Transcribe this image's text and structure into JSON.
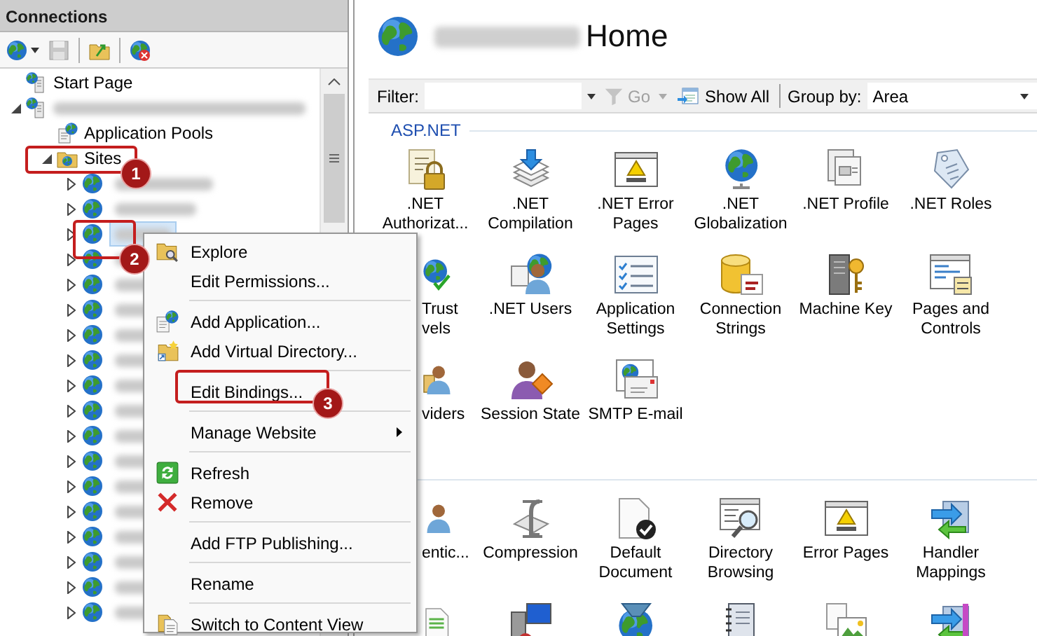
{
  "connections": {
    "title": "Connections",
    "tree": [
      {
        "kind": "start-page",
        "label": "Start Page"
      },
      {
        "kind": "server",
        "expanded": true,
        "children": [
          {
            "kind": "app-pools",
            "label": "Application Pools"
          },
          {
            "kind": "sites",
            "label": "Sites",
            "expanded": true,
            "callout": "1",
            "children": [
              {
                "kind": "site",
                "expanded": false,
                "selected": false
              },
              {
                "kind": "site",
                "expanded": false,
                "selected": false
              },
              {
                "kind": "site",
                "expanded": false,
                "selected": true,
                "callout": "2"
              },
              {
                "kind": "site",
                "expanded": false,
                "selected": false
              },
              {
                "kind": "site",
                "expanded": false,
                "selected": false
              },
              {
                "kind": "site",
                "expanded": false,
                "selected": false
              },
              {
                "kind": "site",
                "expanded": false,
                "selected": false
              },
              {
                "kind": "site",
                "expanded": false,
                "selected": false
              },
              {
                "kind": "site",
                "expanded": false,
                "selected": false
              },
              {
                "kind": "site",
                "expanded": false,
                "selected": false
              },
              {
                "kind": "site",
                "expanded": false,
                "selected": false
              },
              {
                "kind": "site",
                "expanded": false,
                "selected": false
              },
              {
                "kind": "site",
                "expanded": false,
                "selected": false
              },
              {
                "kind": "site",
                "expanded": false,
                "selected": false
              },
              {
                "kind": "site",
                "expanded": false,
                "selected": false
              },
              {
                "kind": "site",
                "expanded": false,
                "selected": false
              },
              {
                "kind": "site",
                "expanded": false,
                "selected": false
              },
              {
                "kind": "site",
                "expanded": false,
                "selected": false
              }
            ]
          }
        ]
      }
    ]
  },
  "home": {
    "title": "Home",
    "filter_bar": {
      "filter_label": "Filter:",
      "go_button": {
        "label": "Go",
        "disabled": true
      },
      "show_all_button": {
        "label": "Show All",
        "disabled": false
      },
      "group_by_label": "Group by:",
      "group_by_value": "Area"
    },
    "groups": [
      {
        "title": "ASP.NET",
        "rows": [
          [
            {
              "kind": "full",
              "label": ".NET Authorizat..."
            },
            {
              "kind": "full",
              "label": ".NET Compilation"
            },
            {
              "kind": "full",
              "label": ".NET Error Pages"
            },
            {
              "kind": "full",
              "label": ".NET Globalization"
            },
            {
              "kind": "full",
              "label": ".NET Profile"
            },
            {
              "kind": "full",
              "label": ".NET Roles"
            }
          ],
          [
            {
              "kind": "cut",
              "label": "Trust vels"
            },
            {
              "kind": "full",
              "label": ".NET Users"
            },
            {
              "kind": "full",
              "label": "Application Settings"
            },
            {
              "kind": "full",
              "label": "Connection Strings"
            },
            {
              "kind": "full",
              "label": "Machine Key"
            },
            {
              "kind": "full",
              "label": "Pages and Controls"
            }
          ],
          [
            {
              "kind": "cut",
              "label": "viders"
            },
            {
              "kind": "full",
              "label": "Session State"
            },
            {
              "kind": "full",
              "label": "SMTP E-mail"
            }
          ]
        ]
      },
      {
        "rows": [
          [
            {
              "kind": "cut",
              "label": "entic..."
            },
            {
              "kind": "full",
              "label": "Compression"
            },
            {
              "kind": "full",
              "label": "Default Document"
            },
            {
              "kind": "full",
              "label": "Directory Browsing"
            },
            {
              "kind": "full",
              "label": "Error Pages"
            },
            {
              "kind": "full",
              "label": "Handler Mappings"
            }
          ],
          [
            {
              "kind": "cut"
            },
            {
              "kind": "icon"
            },
            {
              "kind": "icon"
            },
            {
              "kind": "icon"
            },
            {
              "kind": "icon"
            },
            {
              "kind": "icon"
            }
          ]
        ]
      }
    ]
  },
  "context_menu": {
    "items": [
      {
        "kind": "item",
        "label": "Explore",
        "submenu": false
      },
      {
        "kind": "item",
        "label": "Edit Permissions...",
        "submenu": false
      },
      {
        "kind": "separator"
      },
      {
        "kind": "item",
        "label": "Add Application...",
        "submenu": false
      },
      {
        "kind": "item",
        "label": "Add Virtual Directory...",
        "submenu": false
      },
      {
        "kind": "separator"
      },
      {
        "kind": "item",
        "label": "Edit Bindings...",
        "submenu": false,
        "callout": "3"
      },
      {
        "kind": "separator"
      },
      {
        "kind": "item",
        "label": "Manage Website",
        "submenu": true
      },
      {
        "kind": "separator"
      },
      {
        "kind": "item",
        "label": "Refresh",
        "submenu": false
      },
      {
        "kind": "item",
        "label": "Remove",
        "submenu": false
      },
      {
        "kind": "separator"
      },
      {
        "kind": "item",
        "label": "Add FTP Publishing...",
        "submenu": false
      },
      {
        "kind": "separator"
      },
      {
        "kind": "item",
        "label": "Rename",
        "submenu": false
      },
      {
        "kind": "separator"
      },
      {
        "kind": "item",
        "label": "Switch to Content View",
        "submenu": false
      }
    ]
  }
}
